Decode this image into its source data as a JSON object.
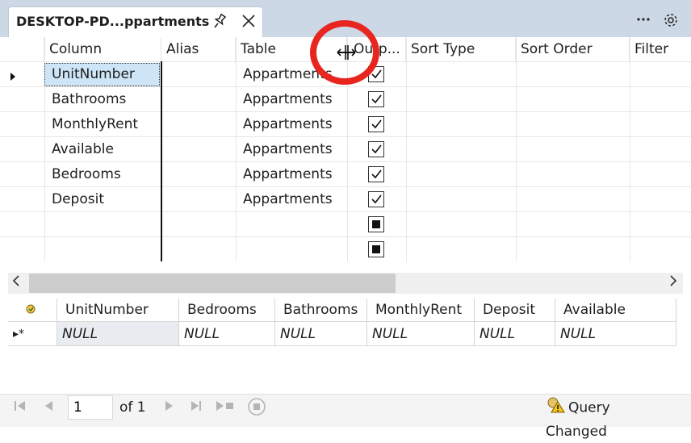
{
  "tab": {
    "title": "DESKTOP-PD...ppartments"
  },
  "criteria": {
    "headers": [
      "Column",
      "Alias",
      "Table",
      "Outp...",
      "Sort Type",
      "Sort Order",
      "Filter"
    ],
    "rows": [
      {
        "column": "UnitNumber",
        "table": "Appartments",
        "output": "checked"
      },
      {
        "column": "Bathrooms",
        "table": "Appartments",
        "output": "checked"
      },
      {
        "column": "MonthlyRent",
        "table": "Appartments",
        "output": "checked"
      },
      {
        "column": "Available",
        "table": "Appartments",
        "output": "checked"
      },
      {
        "column": "Bedrooms",
        "table": "Appartments",
        "output": "checked"
      },
      {
        "column": "Deposit",
        "table": "Appartments",
        "output": "checked"
      },
      {
        "column": "",
        "table": "",
        "output": "indeterminate"
      },
      {
        "column": "",
        "table": "",
        "output": "indeterminate"
      }
    ]
  },
  "results": {
    "headers": [
      "UnitNumber",
      "Bedrooms",
      "Bathrooms",
      "MonthlyRent",
      "Deposit",
      "Available"
    ],
    "row": [
      "NULL",
      "NULL",
      "NULL",
      "NULL",
      "NULL",
      "NULL"
    ],
    "new_row_marker": "▸*"
  },
  "navigation": {
    "record": "1",
    "of_label": "of 1"
  },
  "status": {
    "text": "Query Changed"
  },
  "colors": {
    "annotation": "#e8261f",
    "selection": "#cde5f7"
  }
}
